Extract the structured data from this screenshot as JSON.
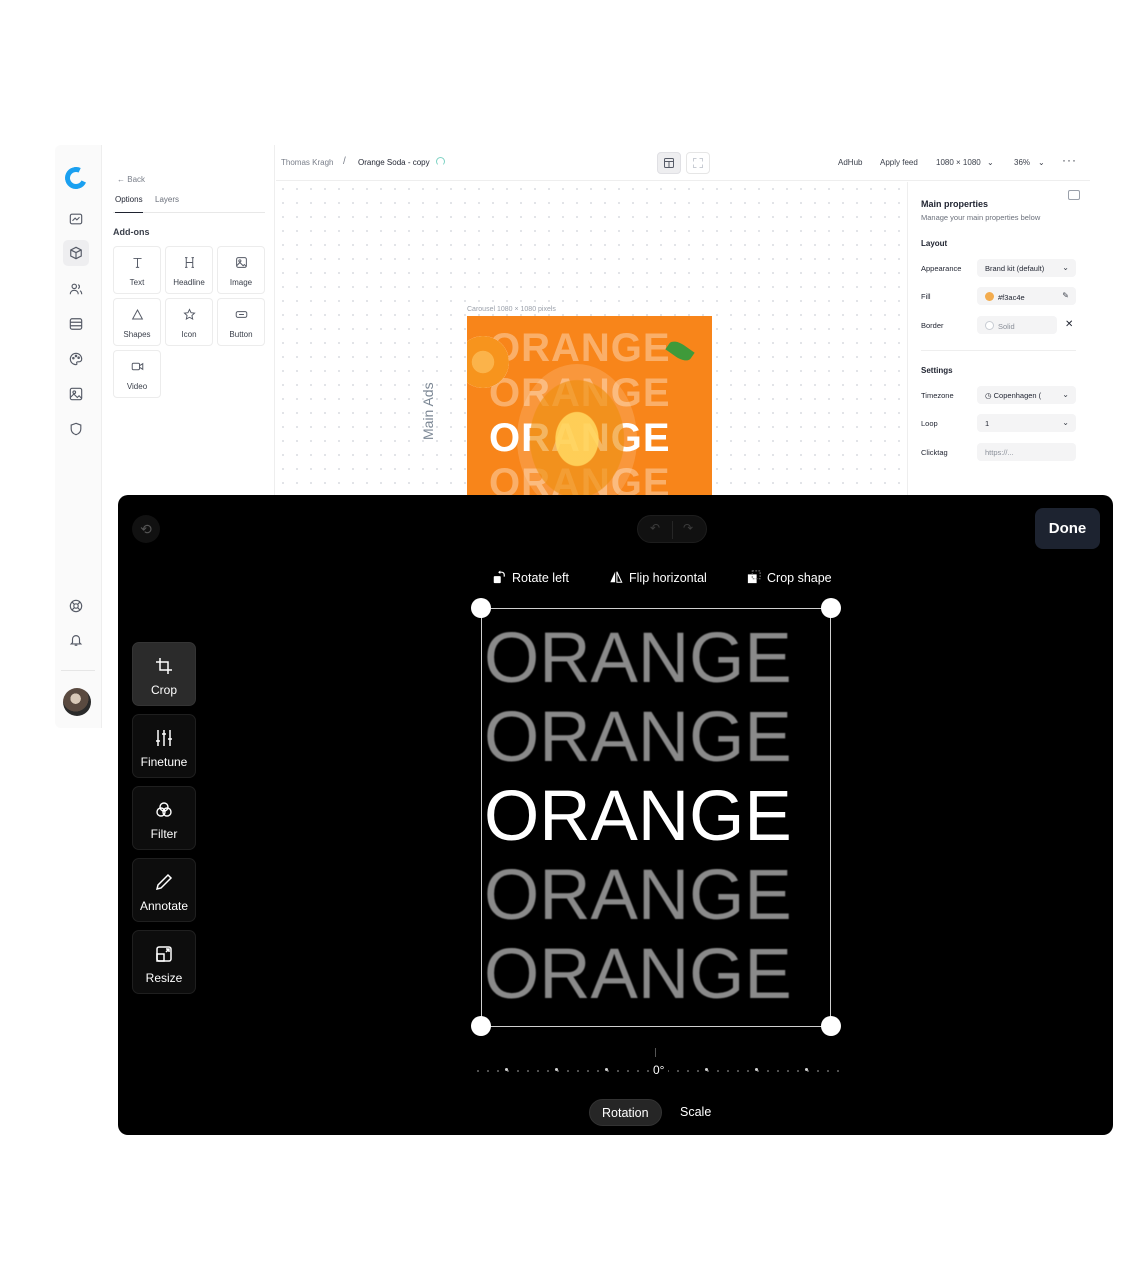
{
  "app": {
    "back_label": "Back",
    "tabs": [
      "Options",
      "Layers"
    ],
    "addons_title": "Add-ons",
    "addons": [
      {
        "label": "Text",
        "icon": "text-icon"
      },
      {
        "label": "Headline",
        "icon": "headline-icon"
      },
      {
        "label": "Image",
        "icon": "image-icon"
      },
      {
        "label": "Shapes",
        "icon": "shapes-icon"
      },
      {
        "label": "Icon",
        "icon": "star-icon"
      },
      {
        "label": "Button",
        "icon": "button-icon"
      },
      {
        "label": "Video",
        "icon": "video-icon"
      }
    ],
    "breadcrumb": {
      "owner": "Thomas Kragh",
      "separator": "/",
      "project": "Orange Soda - copy"
    },
    "toolbar": {
      "adhub": "AdHub",
      "apply_feed": "Apply feed",
      "size": "1080 × 1080",
      "zoom": "36%",
      "more": "···"
    },
    "canvas": {
      "caption": "Carousel 1080 × 1080 pixels",
      "side_label": "Main Ads",
      "artwork_word": "ORANGE"
    },
    "properties": {
      "title": "Main properties",
      "subtitle": "Manage your main properties below",
      "layout_title": "Layout",
      "appearance_label": "Appearance",
      "appearance_value": "Brand kit (default)",
      "fill_label": "Fill",
      "fill_value": "#f3ac4e",
      "fill_color": "#f3ac4e",
      "border_label": "Border",
      "border_value": "Solid",
      "settings_title": "Settings",
      "timezone_label": "Timezone",
      "timezone_value": "Copenhagen (",
      "loop_label": "Loop",
      "loop_value": "1",
      "clicktag_label": "Clicktag",
      "clicktag_placeholder": "https://..."
    }
  },
  "editor": {
    "done_label": "Done",
    "actions": [
      {
        "label": "Rotate left",
        "icon": "rotate-left-icon"
      },
      {
        "label": "Flip horizontal",
        "icon": "flip-horizontal-icon"
      },
      {
        "label": "Crop shape",
        "icon": "crop-shape-icon"
      }
    ],
    "tools": [
      {
        "label": "Crop",
        "icon": "crop-icon",
        "active": true
      },
      {
        "label": "Finetune",
        "icon": "finetune-icon",
        "active": false
      },
      {
        "label": "Filter",
        "icon": "filter-icon",
        "active": false
      },
      {
        "label": "Annotate",
        "icon": "annotate-icon",
        "active": false
      },
      {
        "label": "Resize",
        "icon": "resize-icon",
        "active": false
      }
    ],
    "image_words": [
      "ORANGE",
      "ORANGE",
      "ORANGE",
      "ORANGE",
      "ORANGE"
    ],
    "rotation_value": "0°",
    "modes": [
      {
        "label": "Rotation",
        "active": true
      },
      {
        "label": "Scale",
        "active": false
      }
    ],
    "colors": {
      "background": "#000000",
      "done_bg": "#1d2330",
      "artwork_orange": "#f8851a"
    }
  }
}
